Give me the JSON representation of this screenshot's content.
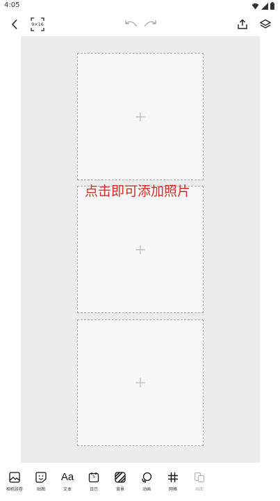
{
  "status": {
    "time": "4:05"
  },
  "toolbar": {
    "ratio_label": "9×16",
    "icons": [
      "back-arrow-icon",
      "undo-icon",
      "redo-icon",
      "share-icon",
      "layers-icon"
    ]
  },
  "canvas": {
    "hint": "点击即可添加照片",
    "accent_color": "#d92b25",
    "slots": 3
  },
  "bottom_tools": [
    {
      "label": "相机胶卷",
      "icon": "photo-icon"
    },
    {
      "label": "贴图",
      "icon": "sticker-icon"
    },
    {
      "label": "文本",
      "icon": "text-icon",
      "glyph": "Aa"
    },
    {
      "label": "日历",
      "icon": "calendar-icon",
      "day": "5"
    },
    {
      "label": "背景",
      "icon": "background-icon"
    },
    {
      "label": "动画",
      "icon": "animation-icon"
    },
    {
      "label": "网格",
      "icon": "grid-icon"
    },
    {
      "label": "画面",
      "icon": "frame-icon",
      "disabled": true
    }
  ]
}
